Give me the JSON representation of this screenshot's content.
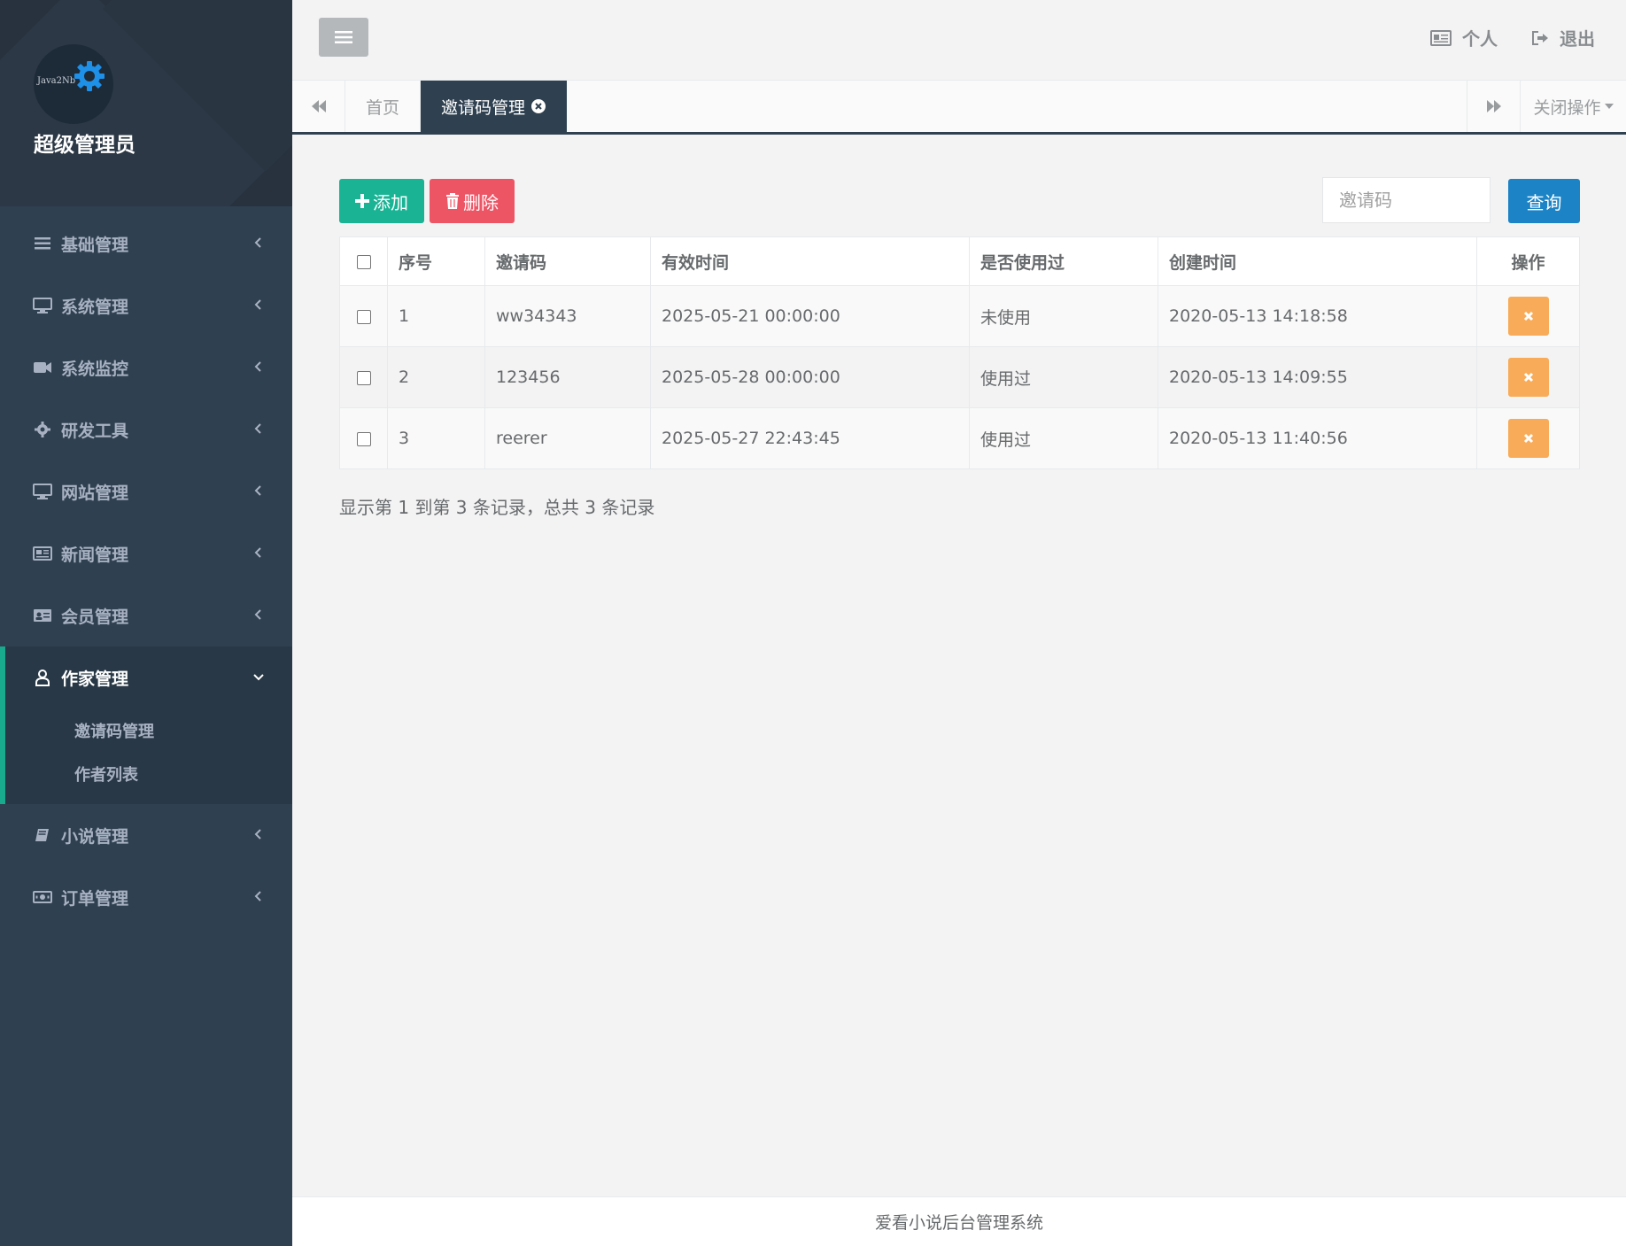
{
  "sidebar": {
    "logo_text": "Java2Nb",
    "admin_name": "超级管理员",
    "items": [
      {
        "label": "基础管理",
        "icon": "bars-icon"
      },
      {
        "label": "系统管理",
        "icon": "desktop-icon"
      },
      {
        "label": "系统监控",
        "icon": "video-camera-icon"
      },
      {
        "label": "研发工具",
        "icon": "gear-icon"
      },
      {
        "label": "网站管理",
        "icon": "desktop-icon"
      },
      {
        "label": "新闻管理",
        "icon": "newspaper-icon"
      },
      {
        "label": "会员管理",
        "icon": "id-card-icon"
      }
    ],
    "active_group": {
      "label": "作家管理",
      "icon": "user-icon",
      "children": [
        "邀请码管理",
        "作者列表"
      ]
    },
    "items_after": [
      {
        "label": "小说管理",
        "icon": "book-icon"
      },
      {
        "label": "订单管理",
        "icon": "money-icon"
      }
    ]
  },
  "topbar": {
    "profile_label": "个人",
    "logout_label": "退出"
  },
  "tabs": {
    "home": "首页",
    "active": "邀请码管理",
    "close_ops": "关闭操作"
  },
  "toolbar": {
    "add_label": "添加",
    "delete_label": "删除",
    "search_placeholder": "邀请码",
    "query_label": "查询"
  },
  "table": {
    "headers": [
      "序号",
      "邀请码",
      "有效时间",
      "是否使用过",
      "创建时间",
      "操作"
    ],
    "rows": [
      {
        "index": "1",
        "code": "ww34343",
        "valid_time": "2025-05-21 00:00:00",
        "used": "未使用",
        "created": "2020-05-13 14:18:58"
      },
      {
        "index": "2",
        "code": "123456",
        "valid_time": "2025-05-28 00:00:00",
        "used": "使用过",
        "created": "2020-05-13 14:09:55"
      },
      {
        "index": "3",
        "code": "reerer",
        "valid_time": "2025-05-27 22:43:45",
        "used": "使用过",
        "created": "2020-05-13 11:40:56"
      }
    ]
  },
  "pagination": {
    "info": "显示第 1 到第 3 条记录，总共 3 条记录"
  },
  "footer": {
    "text": "爱看小说后台管理系统"
  },
  "colors": {
    "sidebar_bg": "#2f4050",
    "accent_green": "#1ab394",
    "danger_red": "#ed5565",
    "primary_blue": "#1c84c6",
    "warning_orange": "#f8ac59"
  }
}
